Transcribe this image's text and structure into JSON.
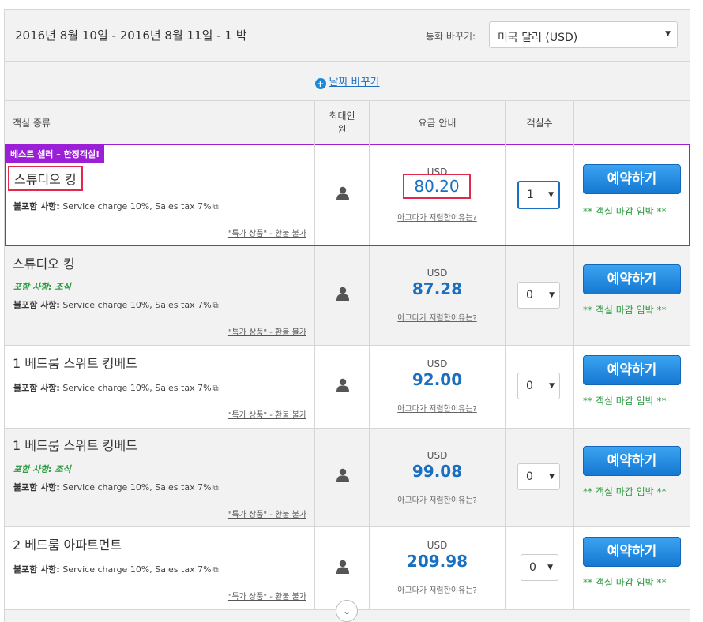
{
  "top": {
    "date_range": "2016년 8월 10일 - 2016년 8월 11일 - 1 박",
    "currency_label": "통화 바꾸기:",
    "currency_value": "미국 달러 (USD)"
  },
  "date_change": {
    "label": "날짜 바꾸기"
  },
  "headers": {
    "room_type": "객실 종류",
    "max_guests": "최대인원",
    "price_info": "요금 안내",
    "num_rooms": "객실수"
  },
  "common": {
    "currency": "USD",
    "why_cheap": "아고다가 저렴한이유는?",
    "non_refundable": "\"특가 상품\" - 환불 불가",
    "book_label": "예약하기",
    "closing": "** 객실 마감 임박 **",
    "excluded_label": "불포함 사항:",
    "excluded_text": "Service charge 10%, Sales tax 7%",
    "included_text": "포함 사항: 조식"
  },
  "badge": "베스트 셀러 – 한정객실!",
  "rooms": [
    {
      "name": "스튜디오 킹",
      "price": "80.20",
      "qty": "1"
    },
    {
      "name": "스튜디오 킹",
      "price": "87.28",
      "qty": "0"
    },
    {
      "name": "1 베드룸 스위트 킹베드",
      "price": "92.00",
      "qty": "0"
    },
    {
      "name": "1 베드룸 스위트 킹베드",
      "price": "99.08",
      "qty": "0"
    },
    {
      "name": "2 베드룸 아파트먼트",
      "price": "209.98",
      "qty": "0"
    }
  ],
  "colors": {
    "accent": "#1a6fc0",
    "badge": "#9b1fd6",
    "highlight_box": "#e0294c",
    "green": "#2b9a3e"
  },
  "icons": [
    "plus-circle-icon",
    "person-icon",
    "external-link-icon",
    "chevron-down-icon"
  ]
}
